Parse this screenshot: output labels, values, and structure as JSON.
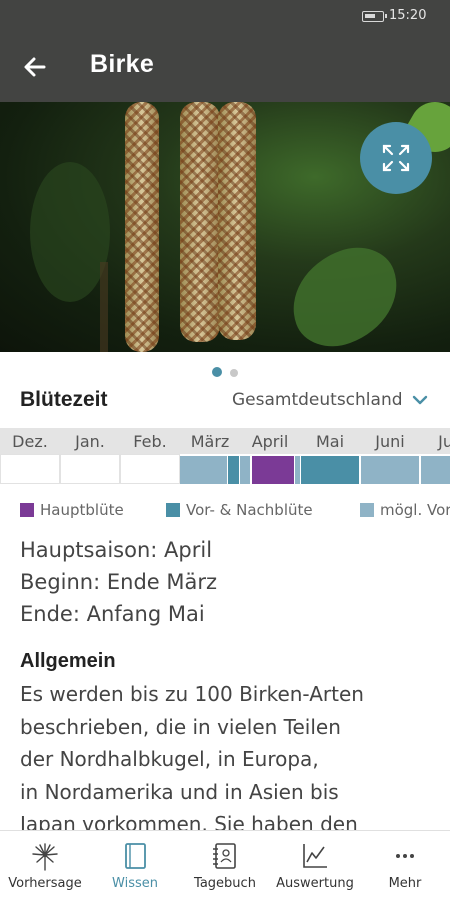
{
  "status_bar": {
    "time": "15:20",
    "battery_icon": "battery-icon"
  },
  "app_bar": {
    "title": "Birke",
    "back_icon": "arrow-left-icon"
  },
  "hero": {
    "image": "birch-catkins-photo",
    "expand_icon": "expand-icon",
    "pager": {
      "current": 1,
      "total": 2
    }
  },
  "bloom": {
    "title": "Blütezeit",
    "region": "Gesamtdeutschland",
    "months": [
      "Dez.",
      "Jan.",
      "Feb.",
      "März",
      "April",
      "Mai",
      "Juni",
      "Juli"
    ],
    "legend": [
      {
        "label": "Hauptblüte",
        "color": "#7b3a96"
      },
      {
        "label": "Vor- & Nachblüte",
        "color": "#4a8fa6"
      },
      {
        "label": "mögl. Vor",
        "color": "#8fb3c6"
      }
    ]
  },
  "season": {
    "main": "Hauptsaison: April",
    "start": "Beginn: Ende März",
    "end": "Ende: Anfang Mai"
  },
  "general": {
    "heading": "Allgemein",
    "lines": [
      "Es werden bis zu 100 Birken-Arten",
      "beschrieben, die in vielen Teilen",
      "der Nordhalbkugel, in Europa,",
      "in Nordamerika und in Asien bis",
      "Japan vorkommen. Sie haben den"
    ]
  },
  "bottom_nav": [
    {
      "label": "Vorhersage",
      "icon": "dandelion-icon",
      "active": false
    },
    {
      "label": "Wissen",
      "icon": "book-icon",
      "active": true
    },
    {
      "label": "Tagebuch",
      "icon": "diary-icon",
      "active": false
    },
    {
      "label": "Auswertung",
      "icon": "chart-icon",
      "active": false
    },
    {
      "label": "Mehr",
      "icon": "more-icon",
      "active": false
    }
  ],
  "colors": {
    "header": "#434442",
    "accent": "#4a8fa6",
    "main_bloom": "#7b3a96",
    "pre_post_bloom": "#4a8fa6",
    "possible_bloom": "#8fb3c6"
  }
}
